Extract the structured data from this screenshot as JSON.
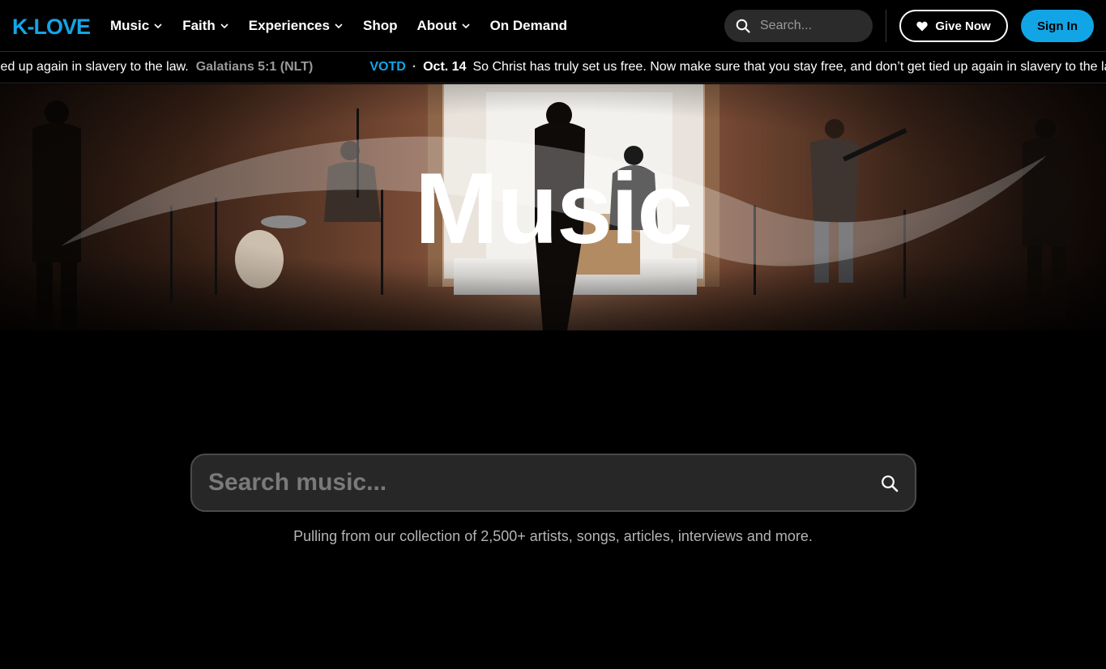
{
  "brand": {
    "logo_text": "K-LOVE",
    "accent": "#12a5e6"
  },
  "nav": {
    "items": [
      {
        "label": "Music",
        "has_dropdown": true
      },
      {
        "label": "Faith",
        "has_dropdown": true
      },
      {
        "label": "Experiences",
        "has_dropdown": true
      },
      {
        "label": "Shop",
        "has_dropdown": false
      },
      {
        "label": "About",
        "has_dropdown": true
      },
      {
        "label": "On Demand",
        "has_dropdown": false
      }
    ],
    "search_placeholder": "Search...",
    "give_label": "Give Now",
    "signin_label": "Sign In"
  },
  "ticker": {
    "verse_tail": "ied up again in slavery to the law.",
    "reference": "Galatians 5:1 (NLT)",
    "votd_label": "VOTD",
    "separator": "·",
    "date": "Oct. 14",
    "verse": "So Christ has truly set us free. Now make sure that you stay free, and don’t get tied up again in slavery to the law."
  },
  "hero": {
    "title": "Music"
  },
  "music_search": {
    "placeholder": "Search music...",
    "caption": "Pulling from our collection of 2,500+ artists, songs, articles, interviews and more."
  }
}
